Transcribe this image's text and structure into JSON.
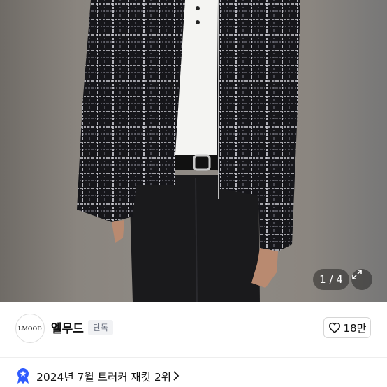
{
  "gallery": {
    "counter": "1 / 4",
    "expand_icon": "expand-icon",
    "image_alt": "product-photo"
  },
  "seller": {
    "logo_text": "LMOOD",
    "name": "엘무드",
    "badge": "단독"
  },
  "like": {
    "icon": "heart-icon",
    "count": "18만"
  },
  "ranking": {
    "icon": "medal-icon",
    "text": "2024년 7월 트러커 재킷 2위",
    "chevron": "chevron-right-icon"
  },
  "colors": {
    "badge_bg": "#f1f2f4",
    "rank_icon": "#2f5bff"
  }
}
